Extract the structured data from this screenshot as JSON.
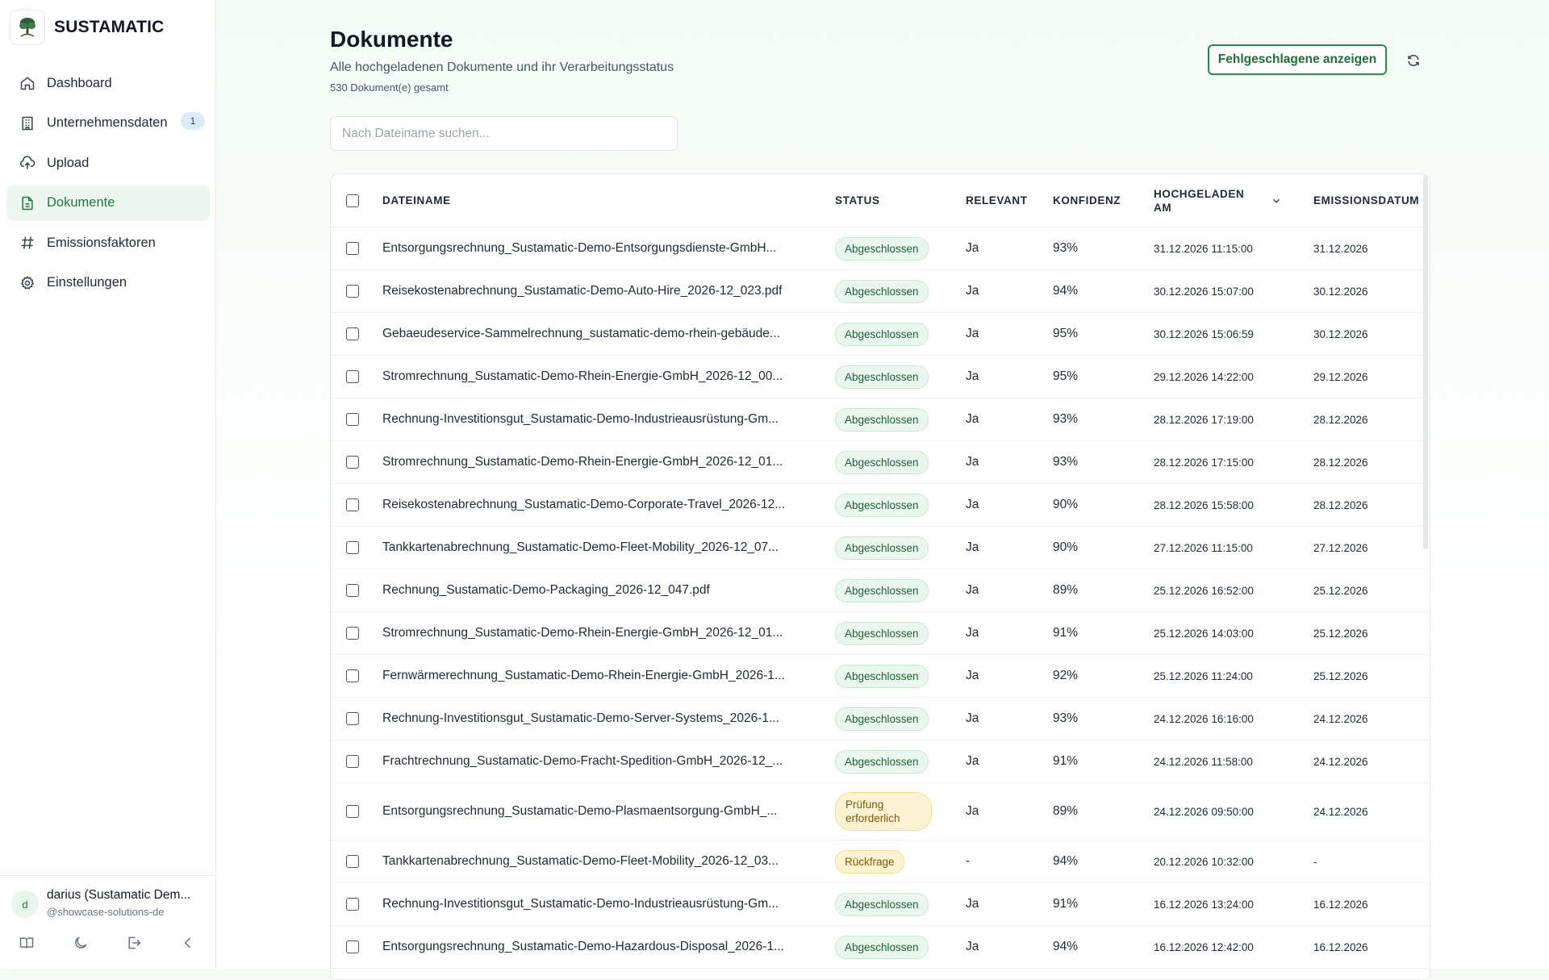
{
  "brand": {
    "name": "SUSTAMATIC"
  },
  "nav": {
    "items": [
      {
        "label": "Dashboard",
        "icon": "home-icon",
        "active": false
      },
      {
        "label": "Unternehmensdaten",
        "icon": "building-icon",
        "active": false,
        "badge": "1"
      },
      {
        "label": "Upload",
        "icon": "cloud-upload-icon",
        "active": false
      },
      {
        "label": "Dokumente",
        "icon": "document-icon",
        "active": true
      },
      {
        "label": "Emissionsfaktoren",
        "icon": "hash-icon",
        "active": false
      },
      {
        "label": "Einstellungen",
        "icon": "gear-icon",
        "active": false
      }
    ]
  },
  "user": {
    "initial": "d",
    "name": "darius (Sustamatic Dem...",
    "handle": "@showcase-solutions-de",
    "actions": [
      "book-icon",
      "moon-icon",
      "logout-icon",
      "chevron-left-icon"
    ]
  },
  "page": {
    "title": "Dokumente",
    "subtitle": "Alle hochgeladenen Dokumente und ihr Verarbeitungsstatus",
    "count": "530 Dokument(e) gesamt",
    "failed_button": "Fehlgeschlagene anzeigen"
  },
  "search": {
    "placeholder": "Nach Dateiname suchen...",
    "value": ""
  },
  "table": {
    "headers": {
      "filename": "DATEINAME",
      "status": "STATUS",
      "relevant": "RELEVANT",
      "confidence": "KONFIDENZ",
      "uploaded": "HOCHGELADEN AM",
      "emission_date": "EMISSIONSDATUM"
    },
    "rows": [
      {
        "filename": "Entsorgungsrechnung_Sustamatic-Demo-Entsorgungsdienste-GmbH...",
        "status": "Abgeschlossen",
        "status_type": "done",
        "relevant": "Ja",
        "confidence": "93%",
        "uploaded": "31.12.2026 11:15:00",
        "emission_date": "31.12.2026"
      },
      {
        "filename": "Reisekostenabrechnung_Sustamatic-Demo-Auto-Hire_2026-12_023.pdf",
        "status": "Abgeschlossen",
        "status_type": "done",
        "relevant": "Ja",
        "confidence": "94%",
        "uploaded": "30.12.2026 15:07:00",
        "emission_date": "30.12.2026"
      },
      {
        "filename": "Gebaeudeservice-Sammelrechnung_sustamatic-demo-rhein-gebäude...",
        "status": "Abgeschlossen",
        "status_type": "done",
        "relevant": "Ja",
        "confidence": "95%",
        "uploaded": "30.12.2026 15:06:59",
        "emission_date": "30.12.2026"
      },
      {
        "filename": "Stromrechnung_Sustamatic-Demo-Rhein-Energie-GmbH_2026-12_00...",
        "status": "Abgeschlossen",
        "status_type": "done",
        "relevant": "Ja",
        "confidence": "95%",
        "uploaded": "29.12.2026 14:22:00",
        "emission_date": "29.12.2026"
      },
      {
        "filename": "Rechnung-Investitionsgut_Sustamatic-Demo-Industrieausrüstung-Gm...",
        "status": "Abgeschlossen",
        "status_type": "done",
        "relevant": "Ja",
        "confidence": "93%",
        "uploaded": "28.12.2026 17:19:00",
        "emission_date": "28.12.2026"
      },
      {
        "filename": "Stromrechnung_Sustamatic-Demo-Rhein-Energie-GmbH_2026-12_01...",
        "status": "Abgeschlossen",
        "status_type": "done",
        "relevant": "Ja",
        "confidence": "93%",
        "uploaded": "28.12.2026 17:15:00",
        "emission_date": "28.12.2026"
      },
      {
        "filename": "Reisekostenabrechnung_Sustamatic-Demo-Corporate-Travel_2026-12...",
        "status": "Abgeschlossen",
        "status_type": "done",
        "relevant": "Ja",
        "confidence": "90%",
        "uploaded": "28.12.2026 15:58:00",
        "emission_date": "28.12.2026"
      },
      {
        "filename": "Tankkartenabrechnung_Sustamatic-Demo-Fleet-Mobility_2026-12_07...",
        "status": "Abgeschlossen",
        "status_type": "done",
        "relevant": "Ja",
        "confidence": "90%",
        "uploaded": "27.12.2026 11:15:00",
        "emission_date": "27.12.2026"
      },
      {
        "filename": "Rechnung_Sustamatic-Demo-Packaging_2026-12_047.pdf",
        "status": "Abgeschlossen",
        "status_type": "done",
        "relevant": "Ja",
        "confidence": "89%",
        "uploaded": "25.12.2026 16:52:00",
        "emission_date": "25.12.2026"
      },
      {
        "filename": "Stromrechnung_Sustamatic-Demo-Rhein-Energie-GmbH_2026-12_01...",
        "status": "Abgeschlossen",
        "status_type": "done",
        "relevant": "Ja",
        "confidence": "91%",
        "uploaded": "25.12.2026 14:03:00",
        "emission_date": "25.12.2026"
      },
      {
        "filename": "Fernwärmerechnung_Sustamatic-Demo-Rhein-Energie-GmbH_2026-1...",
        "status": "Abgeschlossen",
        "status_type": "done",
        "relevant": "Ja",
        "confidence": "92%",
        "uploaded": "25.12.2026 11:24:00",
        "emission_date": "25.12.2026"
      },
      {
        "filename": "Rechnung-Investitionsgut_Sustamatic-Demo-Server-Systems_2026-1...",
        "status": "Abgeschlossen",
        "status_type": "done",
        "relevant": "Ja",
        "confidence": "93%",
        "uploaded": "24.12.2026 16:16:00",
        "emission_date": "24.12.2026"
      },
      {
        "filename": "Frachtrechnung_Sustamatic-Demo-Fracht-Spedition-GmbH_2026-12_...",
        "status": "Abgeschlossen",
        "status_type": "done",
        "relevant": "Ja",
        "confidence": "91%",
        "uploaded": "24.12.2026 11:58:00",
        "emission_date": "24.12.2026"
      },
      {
        "filename": "Entsorgungsrechnung_Sustamatic-Demo-Plasmaentsorgung-GmbH_...",
        "status": "Prüfung erforderlich",
        "status_type": "review",
        "relevant": "Ja",
        "confidence": "89%",
        "uploaded": "24.12.2026 09:50:00",
        "emission_date": "24.12.2026"
      },
      {
        "filename": "Tankkartenabrechnung_Sustamatic-Demo-Fleet-Mobility_2026-12_03...",
        "status": "Rückfrage",
        "status_type": "query",
        "relevant": "-",
        "confidence": "94%",
        "uploaded": "20.12.2026 10:32:00",
        "emission_date": "-"
      },
      {
        "filename": "Rechnung-Investitionsgut_Sustamatic-Demo-Industrieausrüstung-Gm...",
        "status": "Abgeschlossen",
        "status_type": "done",
        "relevant": "Ja",
        "confidence": "91%",
        "uploaded": "16.12.2026 13:24:00",
        "emission_date": "16.12.2026"
      },
      {
        "filename": "Entsorgungsrechnung_Sustamatic-Demo-Hazardous-Disposal_2026-1...",
        "status": "Abgeschlossen",
        "status_type": "done",
        "relevant": "Ja",
        "confidence": "94%",
        "uploaded": "16.12.2026 12:42:00",
        "emission_date": "16.12.2026"
      }
    ]
  },
  "colors": {
    "accent": "#2e8b47",
    "active_bg": "#edf7ef",
    "done_bg": "#eaf7ee",
    "warn_bg": "#fdf3d3"
  }
}
